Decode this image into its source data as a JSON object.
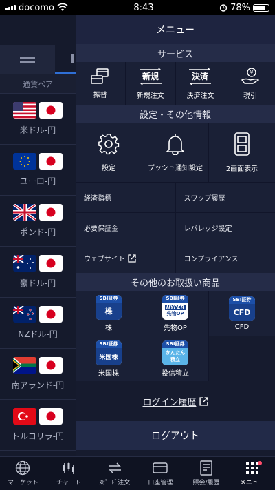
{
  "status_bar": {
    "carrier": "docomo",
    "time": "8:43",
    "battery": "78%",
    "battery_level": 0.78
  },
  "left_pane": {
    "section_label": "通貨ペア",
    "pairs": [
      {
        "name": "米ドル-円"
      },
      {
        "name": "ユーロ-円"
      },
      {
        "name": "ポンド-円"
      },
      {
        "name": "豪ドル-円"
      },
      {
        "name": "NZドル-円"
      },
      {
        "name": "南アランド-円"
      },
      {
        "name": "トルコリラ-円"
      }
    ]
  },
  "menu": {
    "title": "メニュー",
    "services": {
      "header": "サービス",
      "items": [
        {
          "label": "振替",
          "icon": "transfer-icon"
        },
        {
          "label": "新規注文",
          "badge": "新規",
          "icon": "new-order-icon"
        },
        {
          "label": "決済注文",
          "badge": "決済",
          "icon": "settle-order-icon"
        },
        {
          "label": "現引",
          "icon": "yen-hand-icon"
        }
      ]
    },
    "settings": {
      "header": "設定・その他情報",
      "items": [
        {
          "label": "設定",
          "icon": "gear-icon"
        },
        {
          "label": "プッシュ通知設定",
          "icon": "bell-icon"
        },
        {
          "label": "2画面表示",
          "icon": "phone-split-icon"
        }
      ],
      "links": [
        {
          "label": "経済指標"
        },
        {
          "label": "スワップ履歴"
        },
        {
          "label": "必要保証金"
        },
        {
          "label": "レバレッジ設定"
        },
        {
          "label": "ウェブサイト",
          "external": true
        },
        {
          "label": "コンプライアンス"
        }
      ]
    },
    "products": {
      "header": "その他のお取扱い商品",
      "items": [
        {
          "label": "株",
          "brand": "SBI証券",
          "icon_text": "株"
        },
        {
          "label": "先物OP",
          "brand": "SBI証券",
          "icon_text": "先物OP",
          "sub": "HYPER"
        },
        {
          "label": "CFD",
          "brand": "SBI証券",
          "icon_text": "CFD"
        },
        {
          "label": "米国株",
          "brand": "SBI証券",
          "icon_text": "米国株"
        },
        {
          "label": "投信積立",
          "brand": "SBI証券",
          "icon_text": "積立",
          "sub": "かんたん"
        }
      ]
    },
    "login_history": "ログイン履歴",
    "logout": "ログアウト"
  },
  "tabbar": {
    "items": [
      {
        "label": "マーケット",
        "icon": "globe-icon"
      },
      {
        "label": "チャート",
        "icon": "candlestick-icon"
      },
      {
        "label": "ｽﾋﾟｰﾄﾞ注文",
        "icon": "swap-arrows-icon"
      },
      {
        "label": "口座管理",
        "icon": "card-icon"
      },
      {
        "label": "照会/履歴",
        "icon": "document-icon"
      },
      {
        "label": "メニュー",
        "icon": "grid-icon",
        "active": true
      }
    ]
  },
  "colors": {
    "background": "#1b2034",
    "menu_header": "#252c48",
    "accent": "#2f6fd6",
    "notification": "#ff4d6a",
    "sbi_blue": "#1c4fa8"
  }
}
